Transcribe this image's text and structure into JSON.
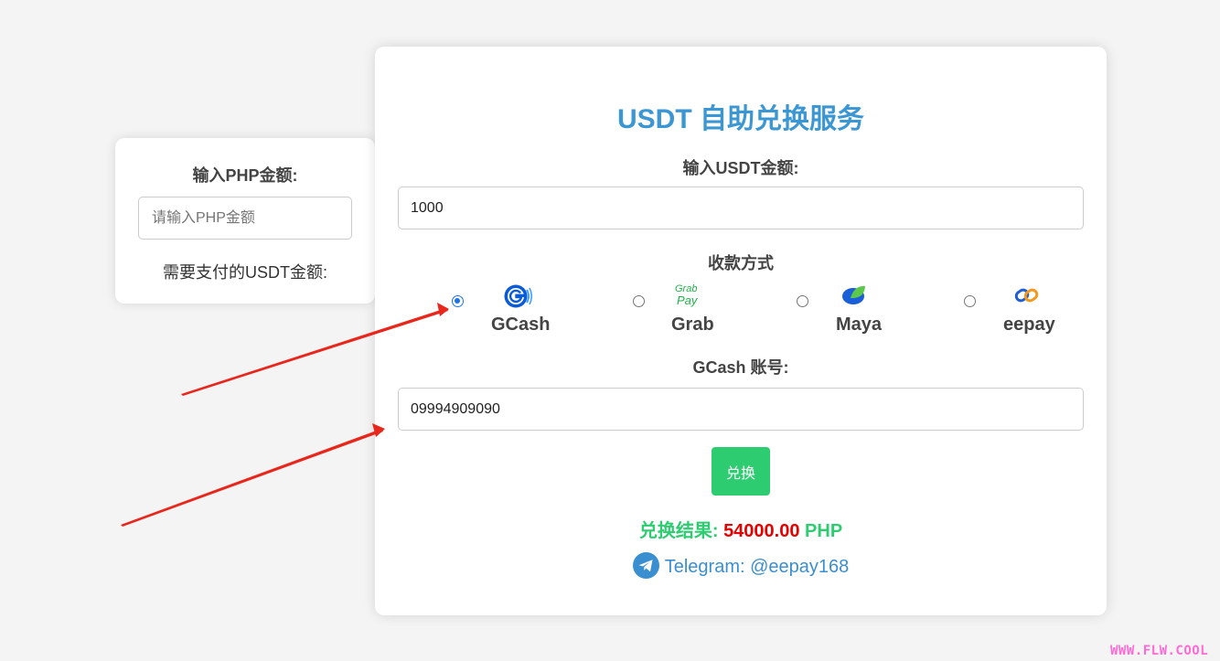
{
  "converter": {
    "title": "输入PHP金额:",
    "php_input_value": "",
    "php_input_placeholder": "请输入PHP金额",
    "usdt_result_label": "需要支付的USDT金额:"
  },
  "exchange_form": {
    "title": "USDT 自助兑换服务",
    "usdt_amount_label": "输入USDT金额:",
    "usdt_amount_value": "1000",
    "payment_method_label": "收款方式",
    "payment_methods": [
      {
        "name": "GCash",
        "icon": "gcash-logo",
        "selected": true
      },
      {
        "name": "Grab",
        "icon": "grab-pay-logo",
        "selected": false
      },
      {
        "name": "Maya",
        "icon": "maya-logo",
        "selected": false
      },
      {
        "name": "eepay",
        "icon": "eepay-logo",
        "selected": false
      }
    ],
    "grab_logo_text_top": "Grab",
    "grab_logo_text_bottom": "Pay",
    "account_label": "GCash 账号:",
    "account_value": "09994909090",
    "submit_label": "兑换",
    "result_prefix": "兑换结果:",
    "result_amount": "54000.00",
    "result_currency": "PHP",
    "telegram_label": "Telegram:",
    "telegram_handle": "@eepay168"
  },
  "watermark": "WWW.FLW.COOL",
  "colors": {
    "title_blue": "#3b97d3",
    "submit_green": "#2ecc71",
    "amount_red": "#e60000",
    "arrow_red": "#e8261c",
    "watermark_pink": "#ff6ad5"
  }
}
